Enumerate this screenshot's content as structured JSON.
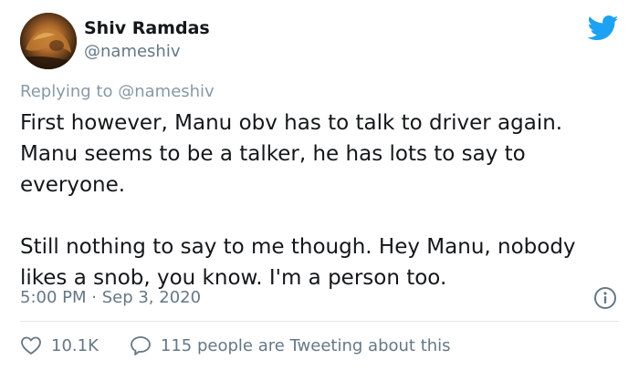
{
  "user": {
    "display_name": "Shiv Ramdas",
    "handle": "@nameshiv"
  },
  "reply": {
    "prefix": "Replying to",
    "mention": "@nameshiv"
  },
  "tweet": {
    "paragraphs": [
      "First however, Manu obv has to talk to driver again. Manu seems to be a talker, he has lots to say to everyone.",
      "Still nothing to say to me though. Hey Manu, nobody likes a snob, you know. I'm a person too."
    ],
    "timestamp": "5:00 PM · Sep 3, 2020"
  },
  "actions": {
    "likes": "10.1K",
    "conversation": "115 people are Tweeting about this"
  },
  "icons": {
    "brand": "twitter-bird-icon",
    "info": "info-icon",
    "like": "heart-icon",
    "comment": "comment-icon"
  },
  "colors": {
    "twitter_blue": "#1da1f2",
    "secondary_text": "#657786",
    "primary_text": "#14171a",
    "divider": "#e1e8ed"
  }
}
